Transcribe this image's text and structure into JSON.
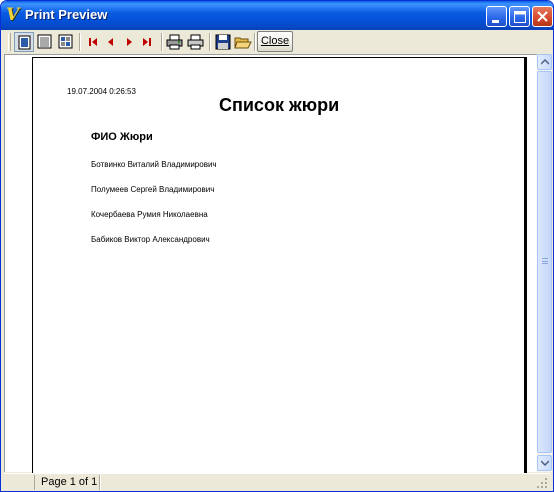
{
  "window": {
    "title": "Print Preview",
    "app_icon": "V"
  },
  "toolbar": {
    "close_label": "Close",
    "buttons": [
      {
        "name": "whole-page-icon"
      },
      {
        "name": "page-width-icon"
      },
      {
        "name": "hundred-percent-icon"
      },
      {
        "name": "first-page-icon"
      },
      {
        "name": "previous-page-icon"
      },
      {
        "name": "next-page-icon"
      },
      {
        "name": "last-page-icon"
      },
      {
        "name": "printer-setup-icon"
      },
      {
        "name": "print-icon"
      },
      {
        "name": "save-icon"
      },
      {
        "name": "open-icon"
      }
    ]
  },
  "report": {
    "timestamp": "19.07.2004 0:26:53",
    "title": "Список жюри",
    "column_header": "ФИО Жюри",
    "rows": [
      "Ботвинко Виталий Владимирович",
      "Полумеев Сергей Владимирович",
      "Кочербаева Румия Николаевна",
      "Бабиков Виктор Александрович"
    ]
  },
  "status": {
    "page_text": "Page 1 of 1"
  },
  "colors": {
    "title_bar": "#0350d8",
    "nav_arrows": "#c00000",
    "window_face": "#ece9d8"
  }
}
